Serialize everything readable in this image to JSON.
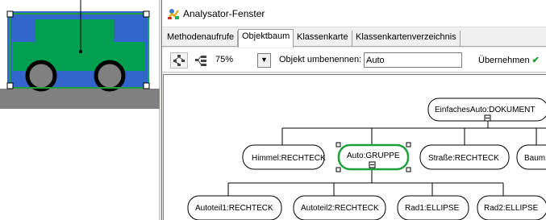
{
  "window": {
    "title": "Analysator-Fenster",
    "app_icon": "analyzer-icon"
  },
  "tabs": [
    {
      "label": "Methodenaufrufe",
      "active": false
    },
    {
      "label": "Objektbaum",
      "active": true
    },
    {
      "label": "Klassenkarte",
      "active": false
    },
    {
      "label": "Klassenkartenverzeichnis",
      "active": false
    }
  ],
  "toolbar": {
    "tree_layout_icon": "tree-layout-icon",
    "horizontal_layout_icon": "horizontal-layout-icon",
    "zoom": "75%",
    "rename_label": "Objekt umbenennen:",
    "rename_value": "Auto",
    "apply_label": "Übernehmen",
    "apply_icon": "checkmark-icon",
    "accent_green": "#1a9a2a"
  },
  "tree": {
    "root": "EinfachesAuto:DOKUMENT",
    "level1": [
      "Himmel:RECHTECK",
      "Auto:GRUPPE",
      "Straße:RECHTECK",
      "Baum"
    ],
    "level2": [
      "Autoteil1:RECHTECK",
      "Autoteil2:RECHTECK",
      "Rad1:ELLIPSE",
      "Rad2:ELLIPSE"
    ],
    "selected": "Auto:GRUPPE",
    "selected_color": "#1e9e3c"
  },
  "drawing": {
    "sky_color": "#3366cc",
    "car_color": "#00a050",
    "wheel_color": "#808080",
    "road_color": "#808080",
    "selection_color": "#1e9e3c"
  }
}
